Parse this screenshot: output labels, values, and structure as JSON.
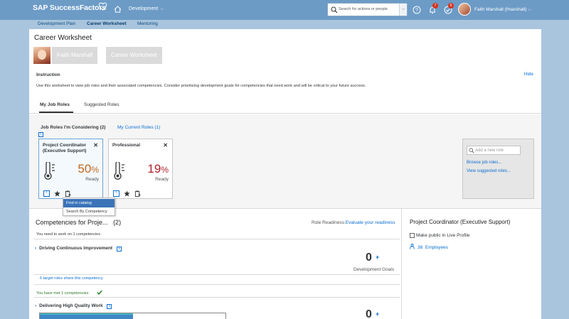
{
  "shell": {
    "logo": "SAP SuccessFactors",
    "module_menu": "Development",
    "search_placeholder": "Search for actions or people",
    "notifications_count": "7",
    "todo_count": "6",
    "user_name": "Faith Marshall (fmarshall)"
  },
  "subnav": {
    "tabs": [
      "Development Plan",
      "Career Worksheet",
      "Mentoring"
    ]
  },
  "page": {
    "title": "Career Worksheet",
    "crumb_user": "Faith Marshall",
    "crumb_page": "Career Worksheet",
    "instruction_title": "Instruction",
    "hide_label": "Hide",
    "instruction_text": "Use this worksheet to view job roles and their associated competencies. Consider prioritizing development goals for competencies that need work and will be critical to your future success.",
    "tabs": [
      "My Job Roles",
      "Suggested Roles"
    ]
  },
  "roles": {
    "considering_label": "Job Roles I'm Considering (2)",
    "current_label": "My Current Roles (1)",
    "cards": [
      {
        "name": "Project Coordinator (Executive Support)",
        "percent_num": "50",
        "percent_sign": "%",
        "ready": "Ready",
        "color": "#c0661f"
      },
      {
        "name": "Professional",
        "percent_num": "19",
        "percent_sign": "%",
        "ready": "Ready",
        "color": "#b21f2d"
      }
    ],
    "close_label": "✕",
    "context_menu": [
      "Find in catalog",
      "Search By Competency"
    ],
    "add_placeholder": "Add a new role",
    "browse_link": "Browse job roles...",
    "suggested_link": "View suggested roles..."
  },
  "competencies": {
    "title": "Competencies for Proje...",
    "count": "(2)",
    "readiness_label": "Role Readiness:",
    "readiness_link": "Evaluate your readiness",
    "need_work": "You need to work on 1 competencies",
    "item1": "Driving Continuous Improvement",
    "zero1": "0",
    "plus": "+",
    "dev_goals": "Development Goals",
    "target_roles": "6 target roles share this competency",
    "met_text": "You have met 1 competencies",
    "item2": "Delivering High Quality Work",
    "zero2": "0",
    "item2_progress": 0.5
  },
  "right_pane": {
    "title": "Project Coordinator (Executive Support)",
    "public_label": "Make public in Live Profile",
    "employees_count": "38",
    "employees_label": "Employees"
  },
  "colors": {
    "shell_bg": "#6c9bc6",
    "link": "#0a6ed1",
    "card_selected_border": "#6ba6d6"
  }
}
